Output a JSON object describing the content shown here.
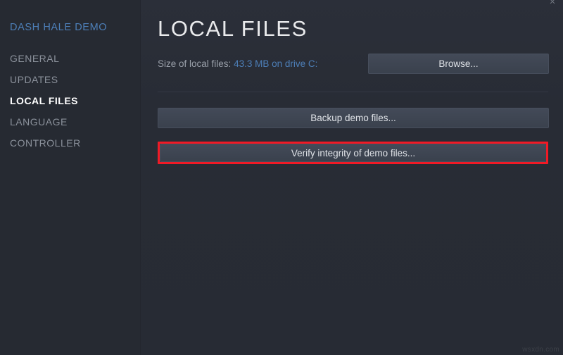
{
  "sidebar": {
    "game_title": "DASH HALE DEMO",
    "items": [
      {
        "label": "GENERAL",
        "active": false
      },
      {
        "label": "UPDATES",
        "active": false
      },
      {
        "label": "LOCAL FILES",
        "active": true
      },
      {
        "label": "LANGUAGE",
        "active": false
      },
      {
        "label": "CONTROLLER",
        "active": false
      }
    ]
  },
  "content": {
    "page_title": "LOCAL FILES",
    "size_label": "Size of local files:",
    "size_value": "43.3 MB on drive C:",
    "buttons": {
      "browse": "Browse...",
      "backup": "Backup demo files...",
      "verify": "Verify integrity of demo files..."
    }
  },
  "window": {
    "close_icon": "×"
  },
  "overlay": {
    "watermark": "wsxdn.com",
    "highlight_color": "#f01a26"
  },
  "colors": {
    "accent_blue": "#4d7fb8",
    "sidebar_bg": "#262a32",
    "content_bg": "#282c35",
    "button_bg": "#3c4350",
    "active_text": "#ffffff",
    "muted_text": "#8b919b"
  }
}
